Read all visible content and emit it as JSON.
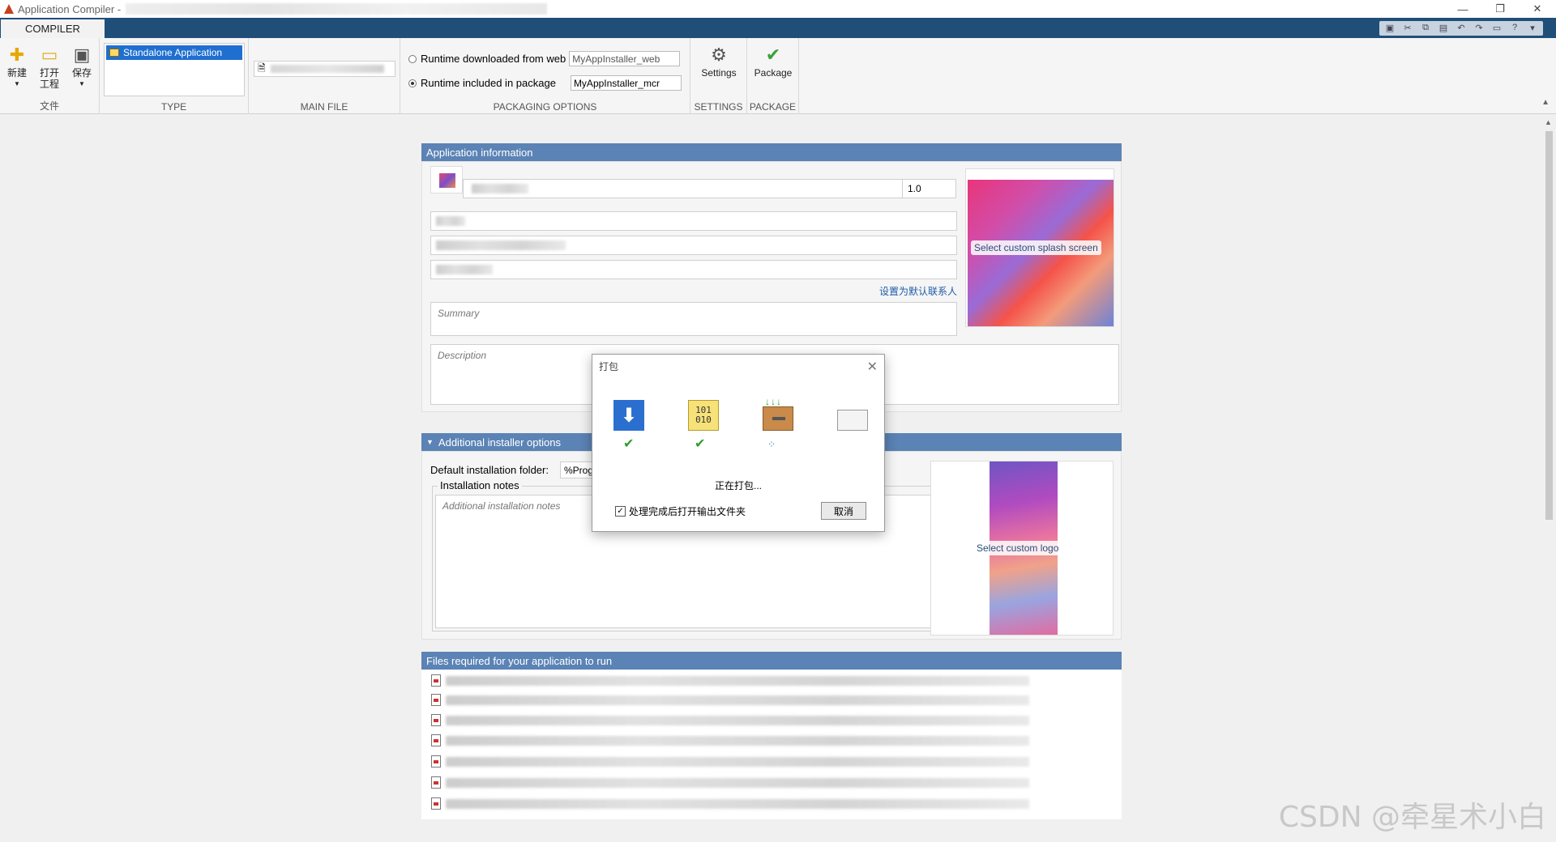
{
  "window": {
    "title": "Application Compiler -"
  },
  "tabs": {
    "compiler": "COMPILER"
  },
  "file_group": {
    "title": "文件",
    "new_label": "新建",
    "open_label": "打开\n工程",
    "save_label": "保存"
  },
  "type_group": {
    "title": "TYPE",
    "selected": "Standalone Application"
  },
  "main_file_group": {
    "title": "MAIN FILE"
  },
  "packaging": {
    "title": "PACKAGING OPTIONS",
    "web_label": "Runtime downloaded from web",
    "web_value": "MyAppInstaller_web",
    "pkg_label": "Runtime included in package",
    "pkg_value": "MyAppInstaller_mcr"
  },
  "settings_group": {
    "title": "SETTINGS",
    "label": "Settings"
  },
  "package_group": {
    "title": "PACKAGE",
    "label": "Package"
  },
  "app_info": {
    "header": "Application information",
    "version": "1.0",
    "default_contact_link": "设置为默认联系人",
    "summary_placeholder": "Summary",
    "description_placeholder": "Description",
    "splash_label": "Select custom splash screen"
  },
  "installer": {
    "header": "Additional installer options",
    "folder_label": "Default installation folder:",
    "folder_value": "%Prog",
    "notes_label": "Installation notes",
    "notes_placeholder": "Additional installation notes",
    "logo_label": "Select custom logo"
  },
  "files": {
    "header": "Files required for your application to run"
  },
  "dialog": {
    "title": "打包",
    "status": "正在打包...",
    "checkbox_label": "处理完成后打开输出文件夹",
    "cancel": "取消"
  },
  "watermark": "CSDN @牵星术小白",
  "colors": {
    "tabbar": "#1f4e79",
    "panel_header": "#5b83b5",
    "selection": "#1f6fd1",
    "check": "#2f9e2f"
  }
}
